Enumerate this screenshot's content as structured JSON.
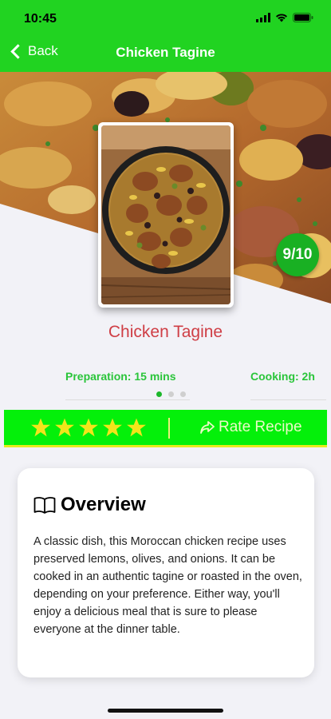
{
  "status_bar": {
    "time": "10:45"
  },
  "nav": {
    "back_label": "Back",
    "title": "Chicken Tagine"
  },
  "hero": {
    "score": "9/10",
    "image_alt": "Chicken tagine in skillet"
  },
  "recipe": {
    "title": "Chicken Tagine",
    "preparation": "Preparation: 15 mins",
    "cooking": "Cooking: 2h",
    "page_count": 3,
    "active_page": 0
  },
  "rating": {
    "stars": 5,
    "rate_label": "Rate Recipe"
  },
  "overview": {
    "title": "Overview",
    "text": "A classic dish, this Moroccan chicken recipe uses preserved lemons, olives, and onions. It can be cooked in an authentic tagine or roasted in the oven, depending on your preference. Either way, you'll enjoy a delicious meal that is sure to please everyone at the dinner table."
  },
  "colors": {
    "nav_green": "#21d321",
    "rating_green": "#04f00a",
    "title_red": "#cf3e45",
    "info_green": "#2ac53a",
    "star_yellow": "#f2e51a",
    "badge_green": "#19b023"
  },
  "icons": [
    "wifi-icon",
    "battery-icon",
    "cellular-icon",
    "chevron-left-icon",
    "star-icon",
    "share-arrow-icon",
    "book-icon"
  ]
}
